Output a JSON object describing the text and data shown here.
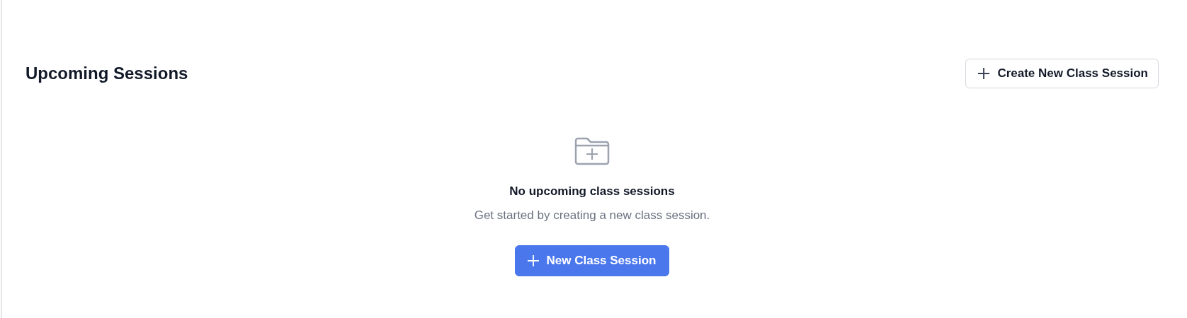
{
  "header": {
    "title": "Upcoming Sessions",
    "action": {
      "label": "Create New Class Session",
      "kind": "outline"
    }
  },
  "empty_state": {
    "heading": "No upcoming class sessions",
    "message": "Get started by creating a new class session.",
    "action": {
      "label": "New Class Session",
      "kind": "primary"
    }
  }
}
